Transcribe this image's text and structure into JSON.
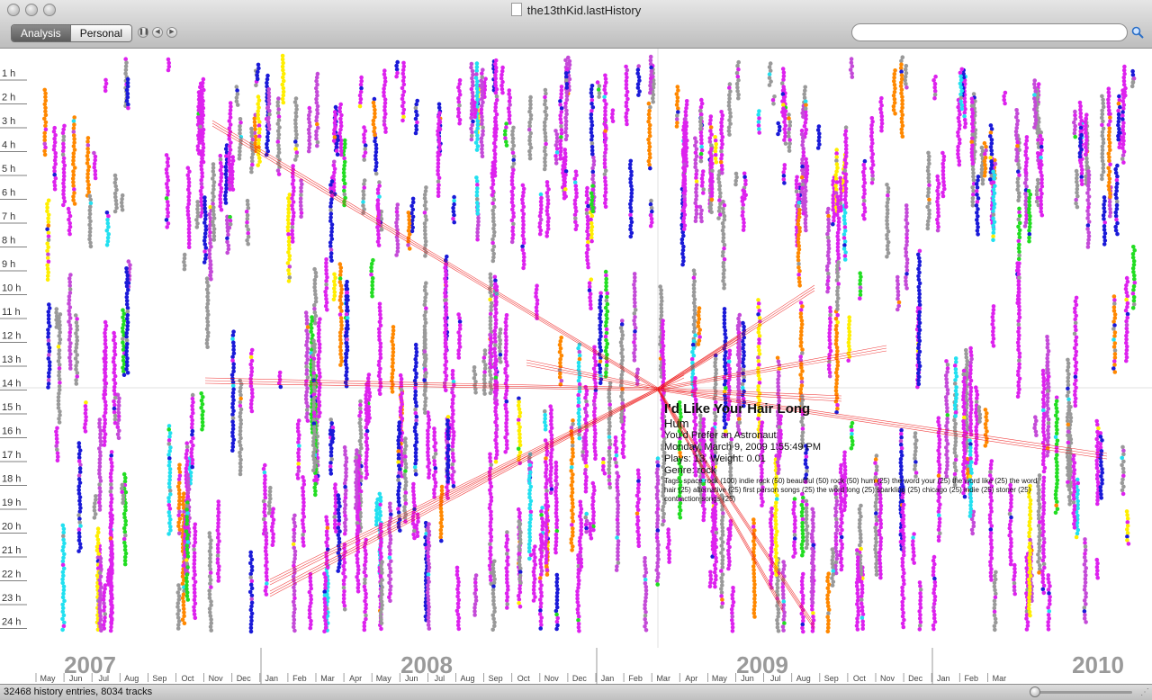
{
  "window": {
    "title": "the13thKid.lastHistory"
  },
  "toolbar": {
    "modes": [
      {
        "label": "Analysis",
        "active": true
      },
      {
        "label": "Personal",
        "active": false
      }
    ],
    "playback_icons": [
      "pause-icon",
      "previous-icon",
      "next-icon"
    ],
    "search": {
      "value": "",
      "placeholder": ""
    }
  },
  "timeline": {
    "hours": [
      "1 h",
      "2 h",
      "3 h",
      "4 h",
      "5 h",
      "6 h",
      "7 h",
      "8 h",
      "9 h",
      "10 h",
      "11 h",
      "12 h",
      "13 h",
      "14 h",
      "15 h",
      "16 h",
      "17 h",
      "18 h",
      "19 h",
      "20 h",
      "21 h",
      "22 h",
      "23 h",
      "24 h"
    ],
    "years": [
      "2007",
      "2008",
      "2009",
      "2010"
    ],
    "months": [
      "May",
      "Jun",
      "Jul",
      "Aug",
      "Sep",
      "Oct",
      "Nov",
      "Dec",
      "Jan",
      "Feb",
      "Mar",
      "Apr",
      "May",
      "Jun",
      "Jul",
      "Aug",
      "Sep",
      "Oct",
      "Nov",
      "Dec",
      "Jan",
      "Feb",
      "Mar",
      "Apr",
      "May",
      "Jun",
      "Jul",
      "Aug",
      "Sep",
      "Oct",
      "Nov",
      "Dec",
      "Jan",
      "Feb",
      "Mar"
    ],
    "colors": [
      "#dd22ee",
      "#c44ad8",
      "#999999",
      "#1a1ad8",
      "#22e0f0",
      "#ff8800",
      "#ffee00",
      "#22dd22"
    ],
    "highlight_color": "#ee1111"
  },
  "tooltip": {
    "track": "I'd Like Your Hair Long",
    "artist": "Hum",
    "album": "You'd Prefer an Astronaut",
    "date": "Monday, March 9, 2009 1:55:49 PM",
    "plays": "Plays: 13, Weight: 0.01",
    "genre": "Genre: rock",
    "tags": "Tags: space rock (100) indie rock (50) beautiful (50) rock (50) hum (25) the word your (25) the word like (25) the word hair (25) alternative (25) first person songs (25) the word long (25) sparkling (25) chicago (25) indie (25) stoner (25) contraction songs (25)"
  },
  "status": {
    "text": "32468 history entries, 8034 tracks"
  }
}
